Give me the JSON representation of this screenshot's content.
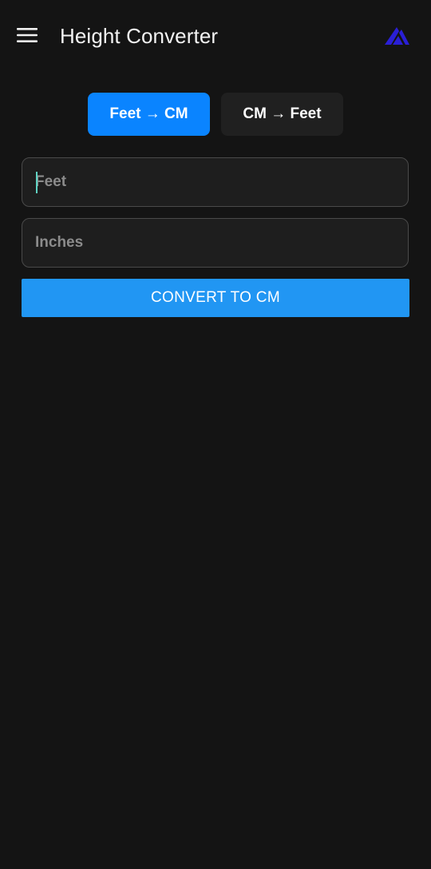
{
  "app_bar": {
    "title": "Height Converter",
    "menu_icon": "hamburger-menu-icon",
    "logo_icon": "app-logo-icon",
    "logo_color": "#2a1fd6"
  },
  "mode_toggle": {
    "options": [
      {
        "label": "Feet → CM",
        "selected": true
      },
      {
        "label": "CM → Feet",
        "selected": false
      }
    ],
    "active_color": "#0a84ff",
    "inactive_color": "#202020"
  },
  "form": {
    "feet": {
      "placeholder": "Feet",
      "value": ""
    },
    "inches": {
      "placeholder": "Inches",
      "value": ""
    },
    "convert_label": "CONVERT TO CM",
    "convert_color": "#2196f3"
  }
}
